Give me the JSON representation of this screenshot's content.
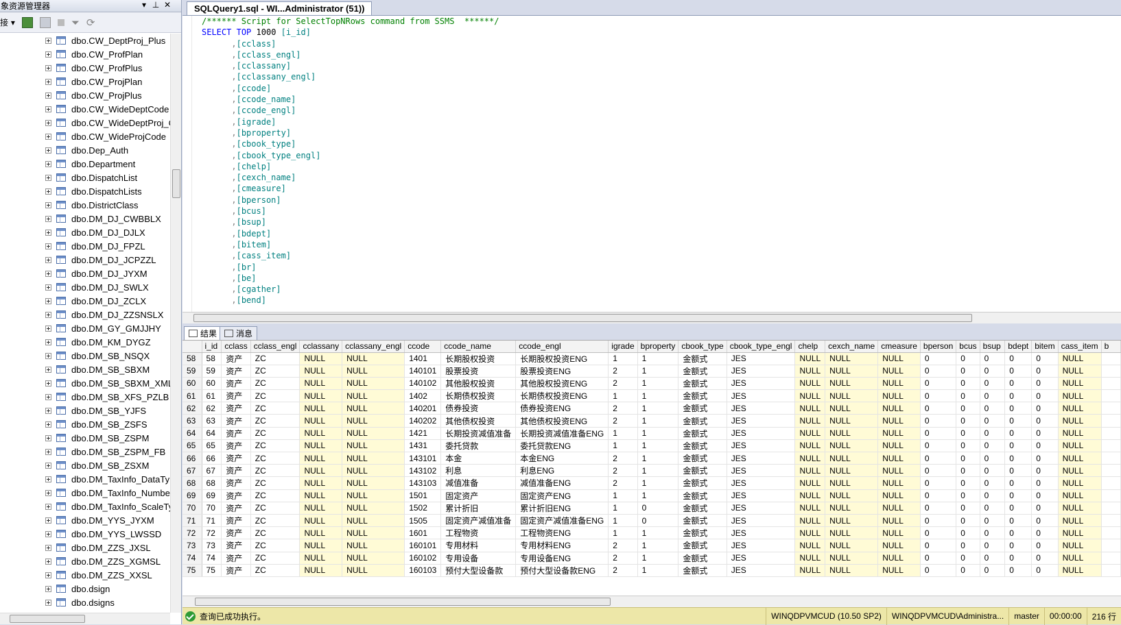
{
  "object_explorer": {
    "title": "象资源管理器",
    "connect_label": "接",
    "items": [
      "dbo.CW_DeptProj_Plus",
      "dbo.CW_ProfPlan",
      "dbo.CW_ProfPlus",
      "dbo.CW_ProjPlan",
      "dbo.CW_ProjPlus",
      "dbo.CW_WideDeptCode",
      "dbo.CW_WideDeptProj_C",
      "dbo.CW_WideProjCode",
      "dbo.Dep_Auth",
      "dbo.Department",
      "dbo.DispatchList",
      "dbo.DispatchLists",
      "dbo.DistrictClass",
      "dbo.DM_DJ_CWBBLX",
      "dbo.DM_DJ_DJLX",
      "dbo.DM_DJ_FPZL",
      "dbo.DM_DJ_JCPZZL",
      "dbo.DM_DJ_JYXM",
      "dbo.DM_DJ_SWLX",
      "dbo.DM_DJ_ZCLX",
      "dbo.DM_DJ_ZZSNSLX",
      "dbo.DM_GY_GMJJHY",
      "dbo.DM_KM_DYGZ",
      "dbo.DM_SB_NSQX",
      "dbo.DM_SB_SBXM",
      "dbo.DM_SB_SBXM_XML",
      "dbo.DM_SB_XFS_PZLB",
      "dbo.DM_SB_YJFS",
      "dbo.DM_SB_ZSFS",
      "dbo.DM_SB_ZSPM",
      "dbo.DM_SB_ZSPM_FB",
      "dbo.DM_SB_ZSXM",
      "dbo.DM_TaxInfo_DataTyp",
      "dbo.DM_TaxInfo_Numbe",
      "dbo.DM_TaxInfo_ScaleTy",
      "dbo.DM_YYS_JYXM",
      "dbo.DM_YYS_LWSSD",
      "dbo.DM_ZZS_JXSL",
      "dbo.DM_ZZS_XGMSL",
      "dbo.DM_ZZS_XXSL",
      "dbo.dsign",
      "dbo.dsigns"
    ]
  },
  "document": {
    "tab_title": "SQLQuery1.sql - WI...Administrator (51))"
  },
  "sql": {
    "comment": "/****** Script for SelectTopNRows command from SSMS  ******/",
    "select": "SELECT",
    "top": "TOP",
    "top_n": "1000",
    "first_column": "[i_id]",
    "columns": [
      "[cclass]",
      "[cclass_engl]",
      "[cclassany]",
      "[cclassany_engl]",
      "[ccode]",
      "[ccode_name]",
      "[ccode_engl]",
      "[igrade]",
      "[bproperty]",
      "[cbook_type]",
      "[cbook_type_engl]",
      "[chelp]",
      "[cexch_name]",
      "[cmeasure]",
      "[bperson]",
      "[bcus]",
      "[bsup]",
      "[bdept]",
      "[bitem]",
      "[cass_item]",
      "[br]",
      "[be]",
      "[cgather]",
      "[bend]"
    ]
  },
  "results": {
    "tab_results": "结果",
    "tab_messages": "消息",
    "headers": [
      "i_id",
      "cclass",
      "cclass_engl",
      "cclassany",
      "cclassany_engl",
      "ccode",
      "ccode_name",
      "ccode_engl",
      "igrade",
      "bproperty",
      "cbook_type",
      "cbook_type_engl",
      "chelp",
      "cexch_name",
      "cmeasure",
      "bperson",
      "bcus",
      "bsup",
      "bdept",
      "bitem",
      "cass_item",
      "b"
    ],
    "rows": [
      [
        "58",
        "58",
        "资产",
        "ZC",
        "NULL",
        "NULL",
        "1401",
        "长期股权投资",
        "长期股权投资ENG",
        "1",
        "1",
        "金额式",
        "JES",
        "NULL",
        "NULL",
        "NULL",
        "0",
        "0",
        "0",
        "0",
        "0",
        "NULL",
        ""
      ],
      [
        "59",
        "59",
        "资产",
        "ZC",
        "NULL",
        "NULL",
        "140101",
        "股票投资",
        "股票投资ENG",
        "2",
        "1",
        "金额式",
        "JES",
        "NULL",
        "NULL",
        "NULL",
        "0",
        "0",
        "0",
        "0",
        "0",
        "NULL",
        ""
      ],
      [
        "60",
        "60",
        "资产",
        "ZC",
        "NULL",
        "NULL",
        "140102",
        "其他股权投资",
        "其他股权投资ENG",
        "2",
        "1",
        "金额式",
        "JES",
        "NULL",
        "NULL",
        "NULL",
        "0",
        "0",
        "0",
        "0",
        "0",
        "NULL",
        ""
      ],
      [
        "61",
        "61",
        "资产",
        "ZC",
        "NULL",
        "NULL",
        "1402",
        "长期债权投资",
        "长期债权投资ENG",
        "1",
        "1",
        "金额式",
        "JES",
        "NULL",
        "NULL",
        "NULL",
        "0",
        "0",
        "0",
        "0",
        "0",
        "NULL",
        ""
      ],
      [
        "62",
        "62",
        "资产",
        "ZC",
        "NULL",
        "NULL",
        "140201",
        "债券投资",
        "债券投资ENG",
        "2",
        "1",
        "金额式",
        "JES",
        "NULL",
        "NULL",
        "NULL",
        "0",
        "0",
        "0",
        "0",
        "0",
        "NULL",
        ""
      ],
      [
        "63",
        "63",
        "资产",
        "ZC",
        "NULL",
        "NULL",
        "140202",
        "其他债权投资",
        "其他债权投资ENG",
        "2",
        "1",
        "金额式",
        "JES",
        "NULL",
        "NULL",
        "NULL",
        "0",
        "0",
        "0",
        "0",
        "0",
        "NULL",
        ""
      ],
      [
        "64",
        "64",
        "资产",
        "ZC",
        "NULL",
        "NULL",
        "1421",
        "长期投资减值准备",
        "长期投资减值准备ENG",
        "1",
        "1",
        "金额式",
        "JES",
        "NULL",
        "NULL",
        "NULL",
        "0",
        "0",
        "0",
        "0",
        "0",
        "NULL",
        ""
      ],
      [
        "65",
        "65",
        "资产",
        "ZC",
        "NULL",
        "NULL",
        "1431",
        "委托贷款",
        "委托贷款ENG",
        "1",
        "1",
        "金额式",
        "JES",
        "NULL",
        "NULL",
        "NULL",
        "0",
        "0",
        "0",
        "0",
        "0",
        "NULL",
        ""
      ],
      [
        "66",
        "66",
        "资产",
        "ZC",
        "NULL",
        "NULL",
        "143101",
        "本金",
        "本金ENG",
        "2",
        "1",
        "金额式",
        "JES",
        "NULL",
        "NULL",
        "NULL",
        "0",
        "0",
        "0",
        "0",
        "0",
        "NULL",
        ""
      ],
      [
        "67",
        "67",
        "资产",
        "ZC",
        "NULL",
        "NULL",
        "143102",
        "利息",
        "利息ENG",
        "2",
        "1",
        "金额式",
        "JES",
        "NULL",
        "NULL",
        "NULL",
        "0",
        "0",
        "0",
        "0",
        "0",
        "NULL",
        ""
      ],
      [
        "68",
        "68",
        "资产",
        "ZC",
        "NULL",
        "NULL",
        "143103",
        "减值准备",
        "减值准备ENG",
        "2",
        "1",
        "金额式",
        "JES",
        "NULL",
        "NULL",
        "NULL",
        "0",
        "0",
        "0",
        "0",
        "0",
        "NULL",
        ""
      ],
      [
        "69",
        "69",
        "资产",
        "ZC",
        "NULL",
        "NULL",
        "1501",
        "固定资产",
        "固定资产ENG",
        "1",
        "1",
        "金额式",
        "JES",
        "NULL",
        "NULL",
        "NULL",
        "0",
        "0",
        "0",
        "0",
        "0",
        "NULL",
        ""
      ],
      [
        "70",
        "70",
        "资产",
        "ZC",
        "NULL",
        "NULL",
        "1502",
        "累计折旧",
        "累计折旧ENG",
        "1",
        "0",
        "金额式",
        "JES",
        "NULL",
        "NULL",
        "NULL",
        "0",
        "0",
        "0",
        "0",
        "0",
        "NULL",
        ""
      ],
      [
        "71",
        "71",
        "资产",
        "ZC",
        "NULL",
        "NULL",
        "1505",
        "固定资产减值准备",
        "固定资产减值准备ENG",
        "1",
        "0",
        "金额式",
        "JES",
        "NULL",
        "NULL",
        "NULL",
        "0",
        "0",
        "0",
        "0",
        "0",
        "NULL",
        ""
      ],
      [
        "72",
        "72",
        "资产",
        "ZC",
        "NULL",
        "NULL",
        "1601",
        "工程物资",
        "工程物资ENG",
        "1",
        "1",
        "金额式",
        "JES",
        "NULL",
        "NULL",
        "NULL",
        "0",
        "0",
        "0",
        "0",
        "0",
        "NULL",
        ""
      ],
      [
        "73",
        "73",
        "资产",
        "ZC",
        "NULL",
        "NULL",
        "160101",
        "专用材料",
        "专用材料ENG",
        "2",
        "1",
        "金额式",
        "JES",
        "NULL",
        "NULL",
        "NULL",
        "0",
        "0",
        "0",
        "0",
        "0",
        "NULL",
        ""
      ],
      [
        "74",
        "74",
        "资产",
        "ZC",
        "NULL",
        "NULL",
        "160102",
        "专用设备",
        "专用设备ENG",
        "2",
        "1",
        "金额式",
        "JES",
        "NULL",
        "NULL",
        "NULL",
        "0",
        "0",
        "0",
        "0",
        "0",
        "NULL",
        ""
      ],
      [
        "75",
        "75",
        "资产",
        "ZC",
        "NULL",
        "NULL",
        "160103",
        "预付大型设备款",
        "预付大型设备款ENG",
        "2",
        "1",
        "金额式",
        "JES",
        "NULL",
        "NULL",
        "NULL",
        "0",
        "0",
        "0",
        "0",
        "0",
        "NULL",
        ""
      ]
    ]
  },
  "status": {
    "message": "查询已成功执行。",
    "server": "WINQDPVMCUD (10.50 SP2)",
    "user": "WINQDPVMCUD\\Administra...",
    "database": "master",
    "elapsed": "00:00:00",
    "rows": "216 行"
  }
}
